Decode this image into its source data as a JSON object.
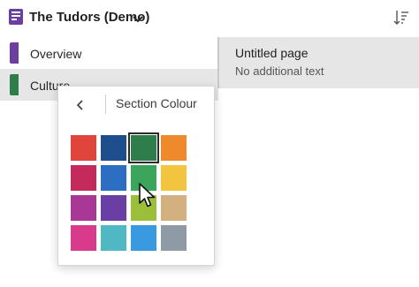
{
  "header": {
    "notebook_title": "The Tudors (Demo)",
    "notebook_icon": "notebook-icon",
    "dropdown_icon": "chevron-down-icon",
    "sort_icon": "sort-icon",
    "notebook_color": "#6b3fa0"
  },
  "sections": {
    "items": [
      {
        "label": "Overview",
        "color": "#6b3fa0",
        "selected": false
      },
      {
        "label": "Culture",
        "color": "#2e7d4a",
        "selected": true
      }
    ]
  },
  "pages": {
    "items": [
      {
        "title": "Untitled page",
        "preview": "No additional text",
        "selected": true
      }
    ]
  },
  "flyout": {
    "title": "Section Colour",
    "back_icon": "chevron-left-icon",
    "swatches": [
      {
        "color": "#e0443a",
        "selected": false
      },
      {
        "color": "#1f4e8c",
        "selected": false
      },
      {
        "color": "#2e7d4a",
        "selected": true
      },
      {
        "color": "#ef8a2c",
        "selected": false
      },
      {
        "color": "#c42b5c",
        "selected": false
      },
      {
        "color": "#2b6ec2",
        "selected": false
      },
      {
        "color": "#3aa55b",
        "selected": false
      },
      {
        "color": "#f3c440",
        "selected": false
      },
      {
        "color": "#a83796",
        "selected": false
      },
      {
        "color": "#6a3fa3",
        "selected": false
      },
      {
        "color": "#9bbf3a",
        "selected": false
      },
      {
        "color": "#d4b080",
        "selected": false
      },
      {
        "color": "#d83b8c",
        "selected": false
      },
      {
        "color": "#4fb8c2",
        "selected": false
      },
      {
        "color": "#3a9ae0",
        "selected": false
      },
      {
        "color": "#8e9aa6",
        "selected": false
      }
    ]
  },
  "cursor": {
    "icon": "mouse-pointer-icon"
  }
}
